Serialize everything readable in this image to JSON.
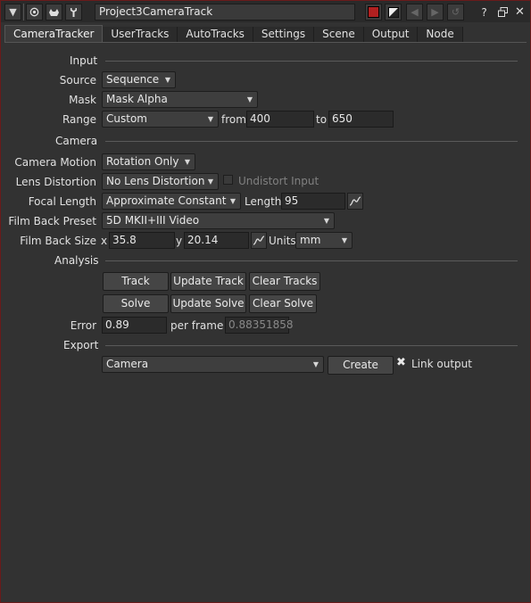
{
  "titlebar": {
    "node_name": "Project3CameraTrack",
    "help": "?"
  },
  "tabs": [
    "CameraTracker",
    "UserTracks",
    "AutoTracks",
    "Settings",
    "Scene",
    "Output",
    "Node"
  ],
  "input": {
    "section": "Input",
    "source_label": "Source",
    "source_value": "Sequence",
    "mask_label": "Mask",
    "mask_value": "Mask Alpha",
    "range_label": "Range",
    "range_value": "Custom",
    "from_label": "from",
    "from_value": "400",
    "to_label": "to",
    "to_value": "650"
  },
  "camera": {
    "section": "Camera",
    "motion_label": "Camera Motion",
    "motion_value": "Rotation Only",
    "lens_label": "Lens Distortion",
    "lens_value": "No Lens Distortion",
    "undistort_label": "Undistort Input",
    "focal_label": "Focal Length",
    "focal_value": "Approximate Constant",
    "length_label": "Length",
    "length_value": "95",
    "filmback_label": "Film Back Preset",
    "filmback_value": "5D MKII+III Video",
    "filmsize_label": "Film Back Size",
    "x_label": "x",
    "x_value": "35.8",
    "y_label": "y",
    "y_value": "20.14",
    "units_label": "Units",
    "units_value": "mm"
  },
  "analysis": {
    "section": "Analysis",
    "track": "Track",
    "update_track": "Update Track",
    "clear_tracks": "Clear Tracks",
    "solve": "Solve",
    "update_solve": "Update Solve",
    "clear_solve": "Clear Solve",
    "error_label": "Error",
    "error_value": "0.89",
    "per_frame_label": "per frame",
    "per_frame_value": "0.88351858"
  },
  "export": {
    "section": "Export",
    "target_value": "Camera",
    "create": "Create",
    "link_output_label": "Link output",
    "link_output_checked": true
  },
  "colors": {
    "background": "#323232",
    "border_accent": "#6a1a1a",
    "node_color_swatch": "#b02020"
  }
}
